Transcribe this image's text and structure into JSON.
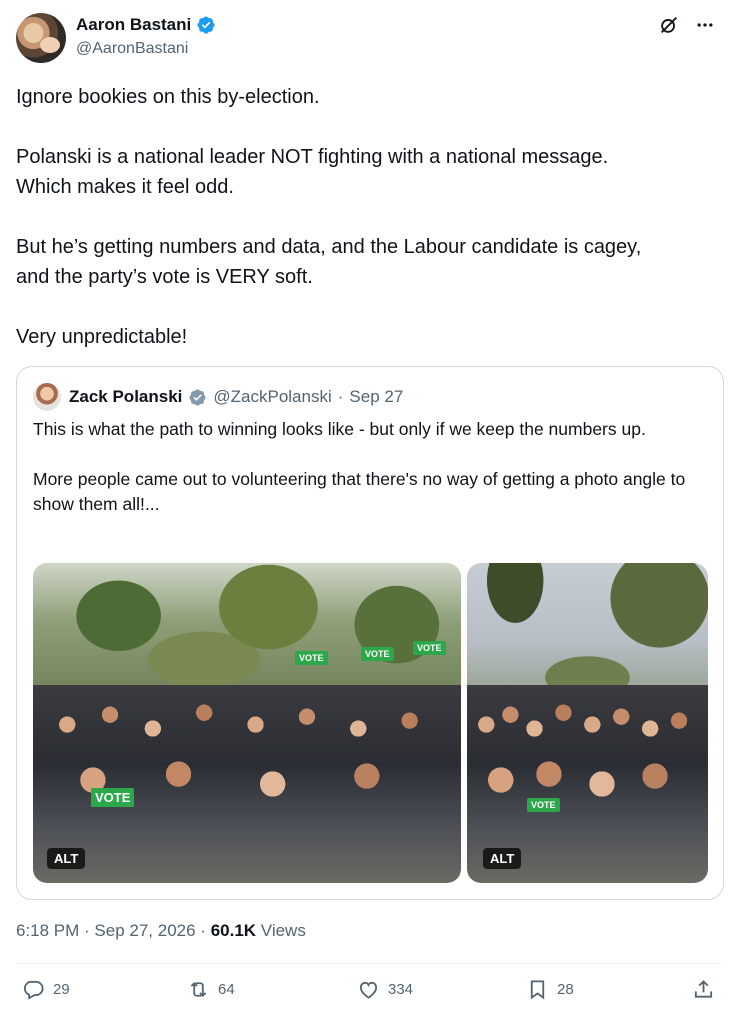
{
  "author": {
    "name": "Aaron Bastani",
    "handle": "@AaronBastani"
  },
  "tweet": {
    "paragraphs": [
      "Ignore bookies on this by-election.",
      "Polanski is a national leader NOT fighting with a national message.\nWhich makes it feel odd.",
      "But he’s getting numbers and data, and the Labour candidate is cagey,\nand the party’s vote is VERY soft.",
      "Very unpredictable!"
    ]
  },
  "quote": {
    "name": "Zack Polanski",
    "handle": "@ZackPolanski",
    "separator": "·",
    "date": "Sep 27",
    "paragraphs": [
      "This is what the path to winning looks like - but only if we keep the numbers up.",
      "More people came out to volunteering that there's no way of getting a photo angle to show them all!..."
    ],
    "photos": [
      {
        "alt_label": "ALT",
        "sign_text": "VOTE"
      },
      {
        "alt_label": "ALT",
        "sign_text": "VOTE"
      }
    ]
  },
  "meta": {
    "time": "6:18 PM",
    "separator": " · ",
    "date": "Sep 27, 2026",
    "views_count": "60.1K",
    "views_label": "Views"
  },
  "actions": {
    "replies": "29",
    "reposts": "64",
    "likes": "334",
    "bookmarks": "28"
  },
  "colors": {
    "verified": "#1d9bf0",
    "quote_verified": "#829aab",
    "secondary_text": "#536471",
    "primary_text": "#0f1419",
    "border": "#cfd9de"
  },
  "icons": [
    "verified-badge-icon",
    "grok-icon",
    "more-icon",
    "reply-icon",
    "repost-icon",
    "like-icon",
    "bookmark-icon",
    "share-icon"
  ]
}
